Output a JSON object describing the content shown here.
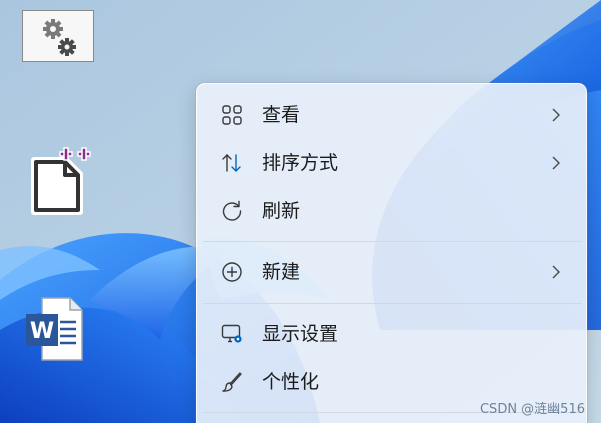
{
  "desktop": {
    "icons": [
      {
        "name": "settings-shortcut",
        "icon": "gears-icon"
      },
      {
        "name": "new-file-shortcut",
        "icon": "new-file-plus-icon"
      },
      {
        "name": "word-document",
        "icon": "word-icon"
      }
    ]
  },
  "context_menu": {
    "items": [
      {
        "label": "查看",
        "icon": "grid-view-icon",
        "has_submenu": true
      },
      {
        "label": "排序方式",
        "icon": "sort-arrows-icon",
        "has_submenu": true
      },
      {
        "label": "刷新",
        "icon": "refresh-icon",
        "has_submenu": false
      },
      {
        "label": "新建",
        "icon": "plus-circle-icon",
        "has_submenu": true
      },
      {
        "label": "显示设置",
        "icon": "display-settings-icon",
        "has_submenu": false
      },
      {
        "label": "个性化",
        "icon": "brush-icon",
        "has_submenu": false
      }
    ]
  },
  "watermark": {
    "text": "CSDN @涟幽516"
  },
  "colors": {
    "accent": "#0067c0",
    "menu_text": "#1b1b1b",
    "wallpaper_blue": "#1e6ef0"
  }
}
